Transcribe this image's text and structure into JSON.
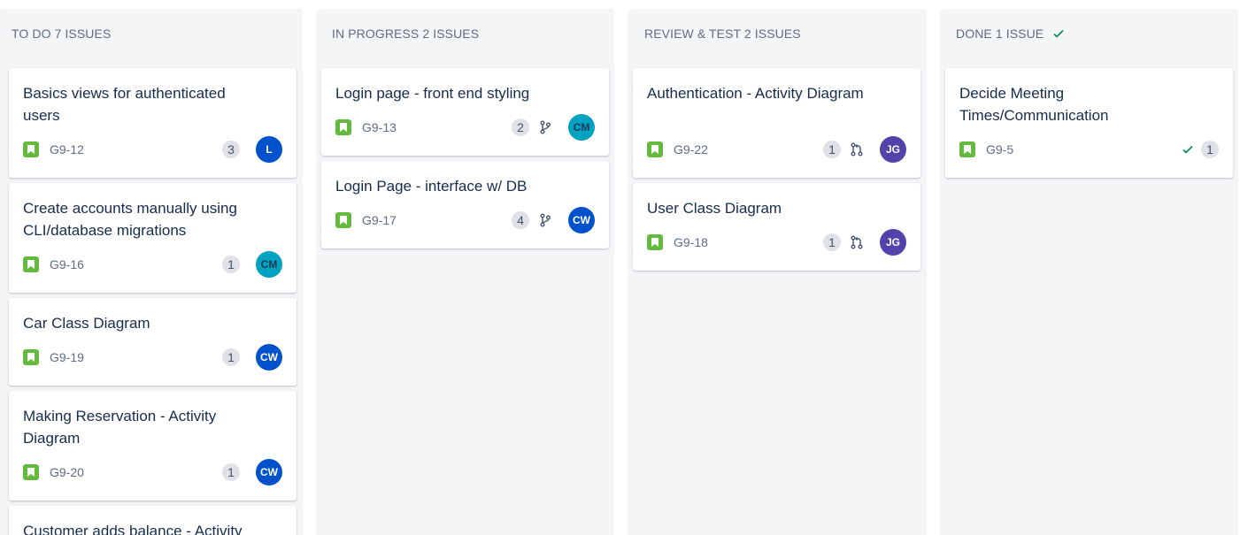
{
  "board": {
    "columns": [
      {
        "title": "TO DO 7 ISSUES",
        "check": false,
        "cards": [
          {
            "title": "Basics views for authenticated users",
            "key": "G9-12",
            "count": "3",
            "avatar": "L",
            "avatar_color": "#0052cc"
          },
          {
            "title": "Create accounts manually using CLI/database migrations",
            "key": "G9-16",
            "count": "1",
            "avatar": "CM",
            "avatar_color": "#00a3bf"
          },
          {
            "title": "Car Class Diagram",
            "key": "G9-19",
            "count": "1",
            "avatar": "CW",
            "avatar_color": "#0052cc"
          },
          {
            "title": "Making Reservation - Activity Diagram",
            "key": "G9-20",
            "count": "1",
            "avatar": "CW",
            "avatar_color": "#0052cc"
          },
          {
            "title": "Customer adds balance - Activity"
          }
        ]
      },
      {
        "title": "IN PROGRESS 2 ISSUES",
        "check": false,
        "cards": [
          {
            "title": "Login page - front end styling",
            "key": "G9-13",
            "count": "2",
            "avatar": "CM",
            "avatar_color": "#00a3bf",
            "branch": "branch-icon"
          },
          {
            "title": "Login Page - interface w/ DB",
            "key": "G9-17",
            "count": "4",
            "avatar": "CW",
            "avatar_color": "#0052cc",
            "branch": "branch-icon"
          }
        ]
      },
      {
        "title": "REVIEW & TEST 2 ISSUES",
        "check": false,
        "cards": [
          {
            "title": "Authentication - Activity Diagram",
            "key": "G9-22",
            "count": "1",
            "avatar": "JG",
            "avatar_color": "#5243aa",
            "branch": "pull-request-icon"
          },
          {
            "title": "User Class Diagram",
            "key": "G9-18",
            "count": "1",
            "avatar": "JG",
            "avatar_color": "#5243aa",
            "branch": "pull-request-icon"
          }
        ]
      },
      {
        "title": "DONE 1 ISSUE",
        "check": true,
        "cards": [
          {
            "title": "Decide Meeting Times/Communication",
            "key": "G9-5",
            "count": "1",
            "done": true
          }
        ]
      }
    ]
  }
}
